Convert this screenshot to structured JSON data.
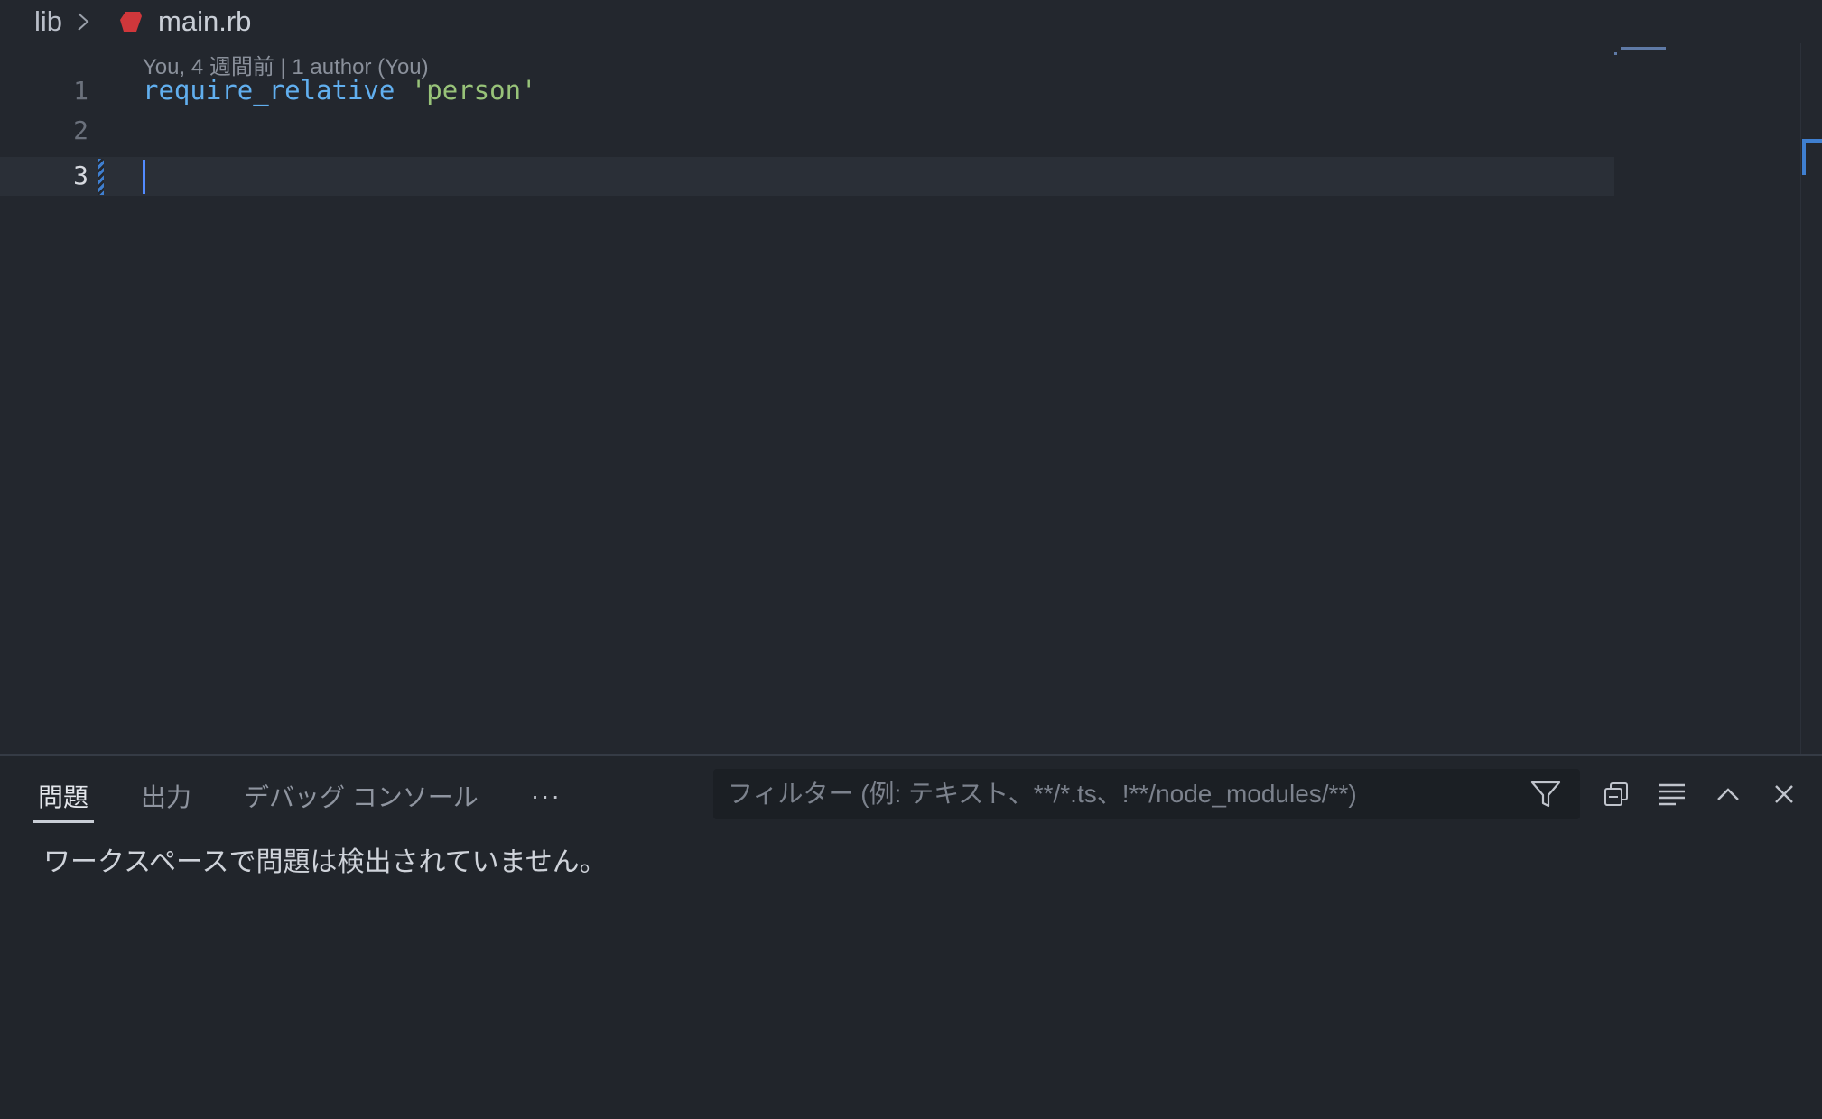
{
  "breadcrumb": {
    "folder": "lib",
    "file": "main.rb",
    "file_icon": "ruby-icon",
    "separator_icon": "chevron-right-icon"
  },
  "editor": {
    "codelens": "You, 4 週間前 | 1 author (You)",
    "lines": [
      {
        "number": "1",
        "keyword": "require_relative",
        "string": "'person'"
      },
      {
        "number": "2"
      },
      {
        "number": "3"
      }
    ]
  },
  "panel": {
    "tabs": [
      {
        "label": "問題",
        "active": true
      },
      {
        "label": "出力",
        "active": false
      },
      {
        "label": "デバッグ コンソール",
        "active": false
      }
    ],
    "more_label": "···",
    "filter": {
      "placeholder": "フィルター (例: テキスト、**/*.ts、!**/node_modules/**)",
      "icon": "filter-icon"
    },
    "actions": [
      "collapse-all-icon",
      "word-wrap-icon",
      "maximize-panel-icon",
      "close-icon"
    ],
    "message": "ワークスペースで問題は検出されていません。"
  },
  "colors": {
    "background": "#23272e",
    "keyword": "#61afef",
    "string": "#98c379",
    "cursor": "#528bff",
    "ruby": "#d0373b"
  }
}
